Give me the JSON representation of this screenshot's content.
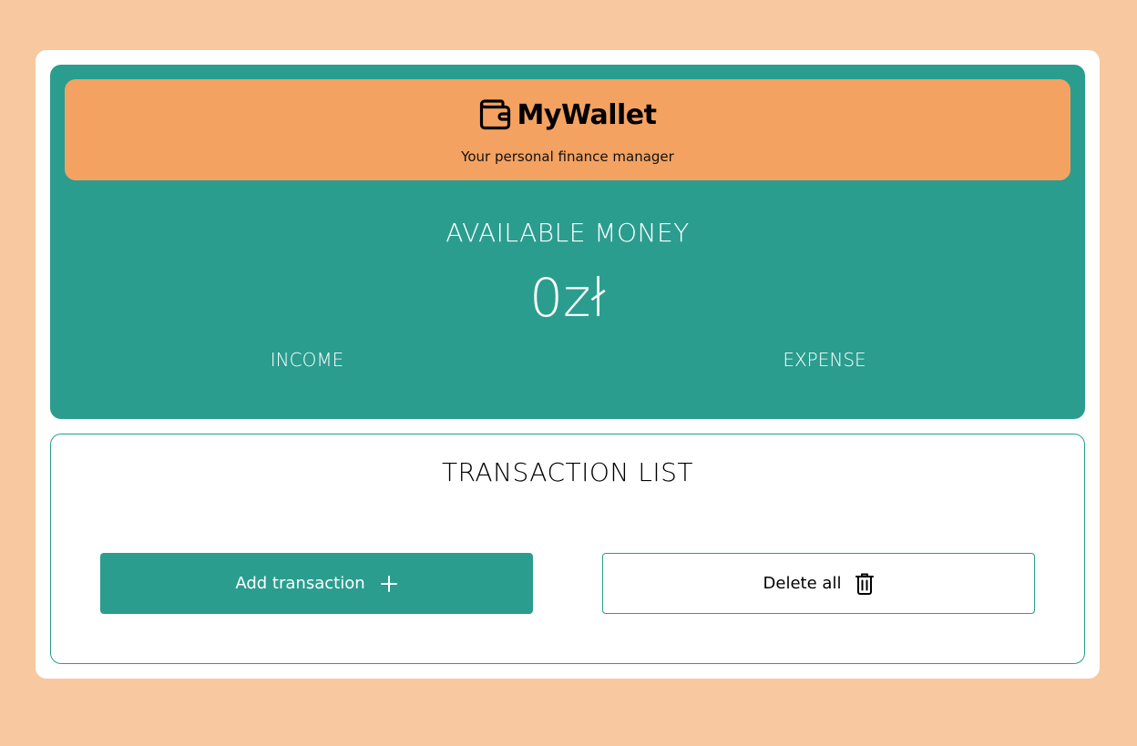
{
  "header": {
    "brand_name": "MyWallet",
    "tagline": "Your personal finance manager",
    "brand_icon": "wallet-icon"
  },
  "summary": {
    "available_label": "AVAILABLE MONEY",
    "available_value": "0zł",
    "income_label": "INCOME",
    "expense_label": "EXPENSE"
  },
  "transactions": {
    "title": "TRANSACTION LIST",
    "add_button_label": "Add transaction",
    "add_button_icon": "plus-icon",
    "delete_button_label": "Delete all",
    "delete_button_icon": "trash-icon"
  },
  "colors": {
    "page_background": "#f8c8a0",
    "panel_background": "#ffffff",
    "primary_teal": "#2a9d8f",
    "header_orange": "#f4a261"
  }
}
